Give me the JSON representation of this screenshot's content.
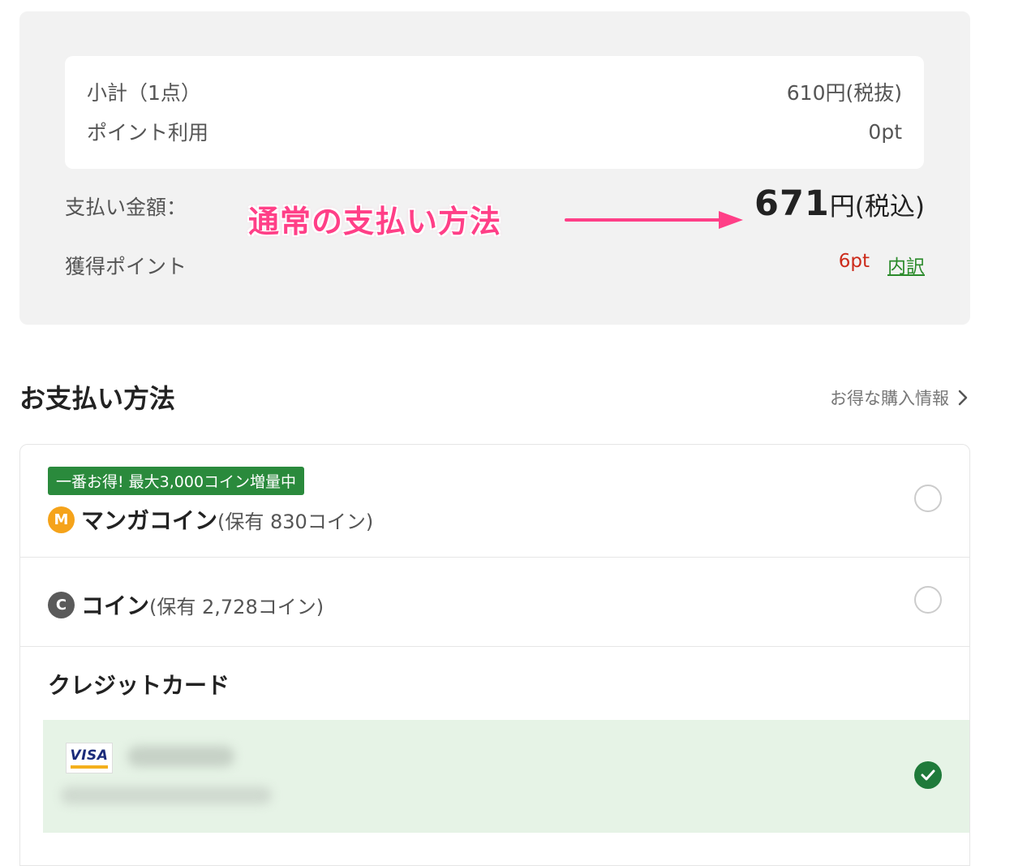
{
  "summary": {
    "subtotal_label": "小計（1点）",
    "subtotal_value": "610円(税抜)",
    "points_used_label": "ポイント利用",
    "points_used_value": "0pt",
    "pay_amount_label": "支払い金額：",
    "annotation": "通常の支払い方法",
    "total_amount": "671",
    "total_unit": "円(税込)",
    "earned_points_label": "獲得ポイント",
    "earned_points_value": "6pt",
    "breakdown_link": "内訳"
  },
  "payment": {
    "title": "お支払い方法",
    "deals_link": "お得な購入情報",
    "options": [
      {
        "badge": "一番お得! 最大3,000コイン増量中",
        "icon_letter": "M",
        "name": "マンガコイン",
        "held": "(保有 830コイン)",
        "selected": false
      },
      {
        "icon_letter": "C",
        "name": "コイン",
        "held": "(保有 2,728コイン)",
        "selected": false
      }
    ],
    "credit_card": {
      "title": "クレジットカード",
      "brand": "VISA",
      "selected": true
    }
  },
  "colors": {
    "accent_green": "#2a8a3c",
    "annotation_pink": "#ff3f87",
    "points_red": "#cc2a1a",
    "coin_orange": "#f5a31a"
  },
  "icons": [
    "manga-coin-icon",
    "coin-icon",
    "chevron-right-icon",
    "visa-logo",
    "check-icon",
    "arrow-annotation"
  ]
}
